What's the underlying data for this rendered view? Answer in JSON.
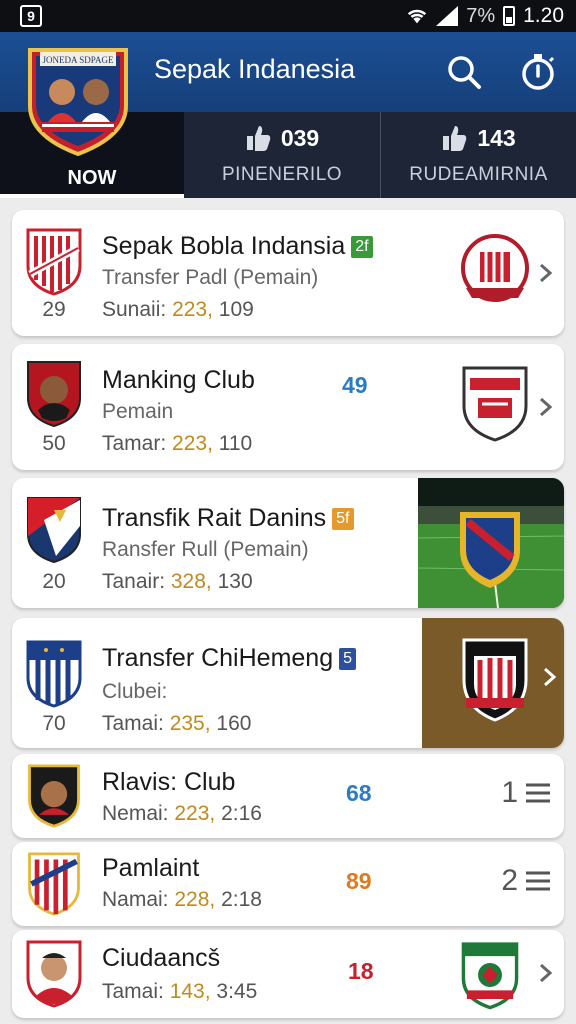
{
  "status_bar": {
    "left_icon": "9",
    "battery": "7%",
    "time": "1.20"
  },
  "header": {
    "title": "Sepak Indanesia",
    "logo_text": "JONEDA SDPAGE",
    "search_icon": "search-icon",
    "timer_icon": "stopwatch-icon",
    "bar_color": "#1b4f94"
  },
  "tabs": [
    {
      "label": "NOW"
    },
    {
      "count": "039",
      "label": "PINENERILO"
    },
    {
      "count": "143",
      "label": "RUDEAMIRNIA"
    }
  ],
  "items": [
    {
      "name": "Sepak Bobla Indansia",
      "badge": "2f",
      "badge_color": "#3a9a3a",
      "sub": "Transfer Padl (Pemain)",
      "rank": "29",
      "meta_label": "Sunaii:",
      "meta_hi": "223,",
      "meta_rest": "109"
    },
    {
      "name": "Manking Club",
      "number": "49",
      "number_color": "#2a7cc7",
      "sub": "Pemain",
      "rank": "50",
      "meta_label": "Tamar:",
      "meta_hi": "223,",
      "meta_rest": "110"
    },
    {
      "name": "Transfik Rait Danins",
      "badge": "5f",
      "badge_color": "#e39a2a",
      "sub": "Ransfer Rull (Pemain)",
      "rank": "20",
      "meta_label": "Tanair:",
      "meta_hi": "328,",
      "meta_rest": "130"
    },
    {
      "name": "Transfer ChiHemeng",
      "badge": "5",
      "badge_color": "#2c4f9e",
      "sub": "Clubei:",
      "rank": "70",
      "meta_label": "Tamai:",
      "meta_hi": "235,",
      "meta_rest": "160"
    },
    {
      "name": "Rlavis: Club",
      "number": "68",
      "number_color": "#2a7cc7",
      "meta_label": "Nemai:",
      "meta_hi": "223,",
      "meta_rest": "2:16",
      "queue": "1"
    },
    {
      "name": "Pamlaint",
      "number": "89",
      "number_color": "#e07a1e",
      "meta_label": "Namai:",
      "meta_hi": "228,",
      "meta_rest": "2:18",
      "queue": "2"
    },
    {
      "name": "Ciudaancš",
      "number": "18",
      "number_color": "#c8202e",
      "meta_label": "Tamai:",
      "meta_hi": "143,",
      "meta_rest": "3:45"
    }
  ]
}
